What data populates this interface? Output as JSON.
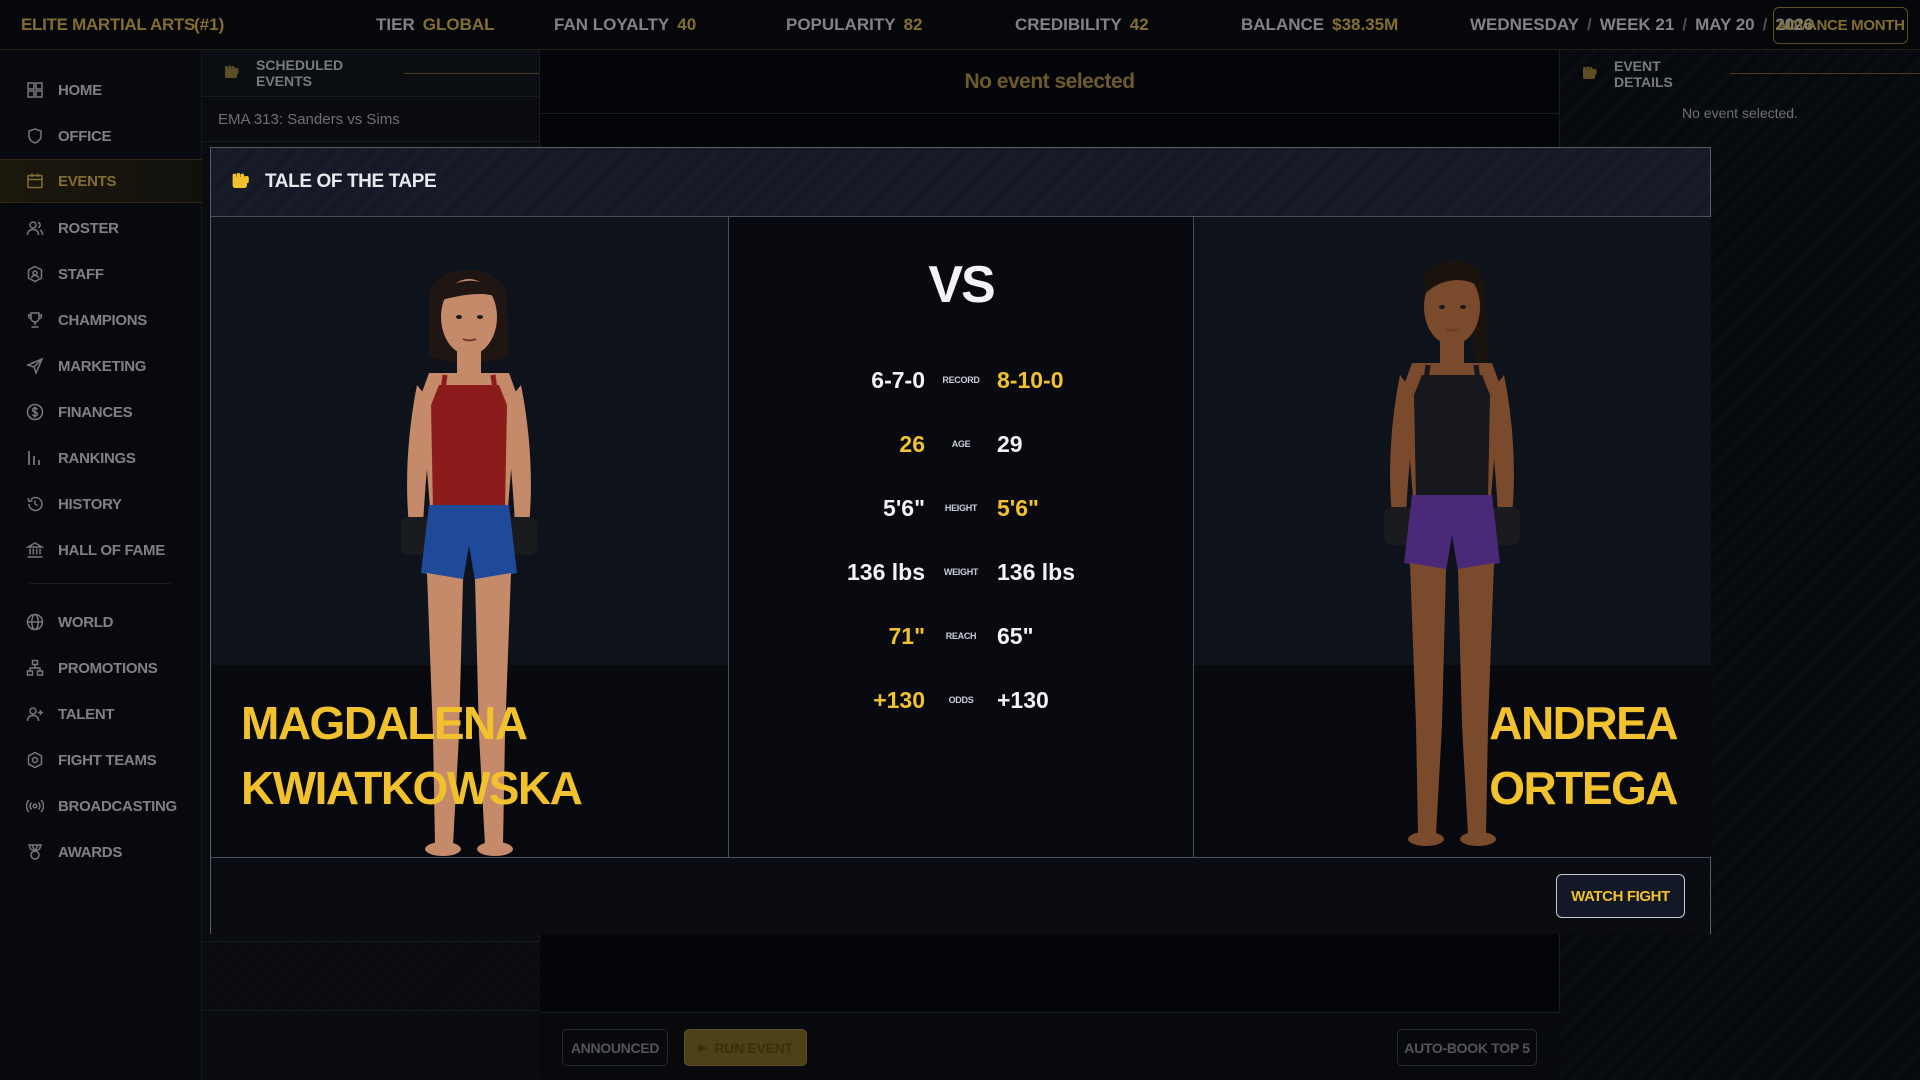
{
  "topbar": {
    "brand": "ELITE MARTIAL ARTS",
    "rank": "(#1)",
    "stats": [
      {
        "label": "TIER",
        "value": "GLOBAL"
      },
      {
        "label": "FAN LOYALTY",
        "value": "40"
      },
      {
        "label": "POPULARITY",
        "value": "82"
      },
      {
        "label": "CREDIBILITY",
        "value": "42"
      },
      {
        "label": "BALANCE",
        "value": "$38.35M"
      }
    ],
    "date": {
      "day": "WEDNESDAY",
      "week": "WEEK 21",
      "date": "MAY 20",
      "year": "2026",
      "separator": "/"
    },
    "advance_label": "ADVANCE MONTH"
  },
  "sidebar": {
    "items": [
      {
        "label": "HOME",
        "icon": "grid-icon"
      },
      {
        "label": "OFFICE",
        "icon": "shield-icon"
      },
      {
        "label": "EVENTS",
        "icon": "calendar-icon",
        "active": true
      },
      {
        "label": "ROSTER",
        "icon": "users-icon"
      },
      {
        "label": "STAFF",
        "icon": "badge-icon"
      },
      {
        "label": "CHAMPIONS",
        "icon": "trophy-icon"
      },
      {
        "label": "MARKETING",
        "icon": "send-icon"
      },
      {
        "label": "FINANCES",
        "icon": "dollar-icon"
      },
      {
        "label": "RANKINGS",
        "icon": "bar-chart-icon"
      },
      {
        "label": "HISTORY",
        "icon": "history-icon"
      },
      {
        "label": "HALL OF FAME",
        "icon": "landmark-icon"
      },
      {
        "label": "WORLD",
        "icon": "globe-icon"
      },
      {
        "label": "PROMOTIONS",
        "icon": "network-icon"
      },
      {
        "label": "TALENT",
        "icon": "user-plus-icon"
      },
      {
        "label": "FIGHT TEAMS",
        "icon": "hexagon-icon"
      },
      {
        "label": "BROADCASTING",
        "icon": "broadcast-icon"
      },
      {
        "label": "AWARDS",
        "icon": "award-icon"
      }
    ]
  },
  "scheduled": {
    "title": "SCHEDULED EVENTS",
    "events": [
      "EMA 313: Sanders vs Sims"
    ]
  },
  "center": {
    "header": "No event selected",
    "announced_label": "ANNOUNCED",
    "run_label": "RUN EVENT",
    "autobook_label": "AUTO-BOOK TOP 5"
  },
  "details": {
    "title": "EVENT DETAILS",
    "message": "No event selected."
  },
  "modal": {
    "title": "TALE OF THE TAPE",
    "vs": "VS",
    "fighter_left": {
      "first": "MAGDALENA",
      "last": "KWIATKOWSKA",
      "top_color": "#8c1c1c",
      "shorts_color": "#1f4a9a",
      "skin": "#c48a6a",
      "hair": "#1f1512"
    },
    "fighter_right": {
      "first": "ANDREA",
      "last": "ORTEGA",
      "top_color": "#16181d",
      "shorts_color": "#4a2a78",
      "skin": "#7a4a2c",
      "hair": "#1a120d"
    },
    "rows": [
      {
        "label": "RECORD",
        "left": "6-7-0",
        "right": "8-10-0",
        "highlight": "right"
      },
      {
        "label": "AGE",
        "left": "26",
        "right": "29",
        "highlight": "left"
      },
      {
        "label": "HEIGHT",
        "left": "5'6\"",
        "right": "5'6\"",
        "highlight": "right"
      },
      {
        "label": "WEIGHT",
        "left": "136 lbs",
        "right": "136 lbs",
        "highlight": "none"
      },
      {
        "label": "REACH",
        "left": "71\"",
        "right": "65\"",
        "highlight": "left"
      },
      {
        "label": "ODDS",
        "left": "+130",
        "right": "+130",
        "highlight": "left"
      }
    ],
    "watch_label": "WATCH FIGHT"
  },
  "colors": {
    "accent_gold": "#f2c12e",
    "muted_gold": "#c9a94a"
  }
}
